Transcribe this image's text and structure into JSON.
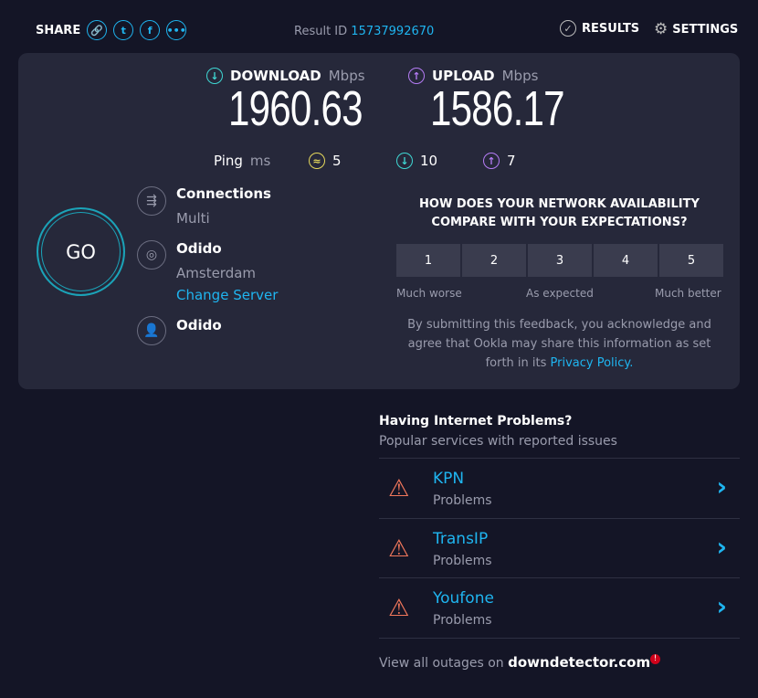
{
  "header": {
    "share": "SHARE",
    "result_id_label": "Result ID",
    "result_id": "15737992670",
    "results": "RESULTS",
    "settings": "SETTINGS"
  },
  "speed": {
    "download_label": "DOWNLOAD",
    "upload_label": "UPLOAD",
    "unit": "Mbps",
    "download": "1960.63",
    "upload": "1586.17",
    "ping_label": "Ping",
    "ping_unit": "ms",
    "ping_idle": "5",
    "ping_down": "10",
    "ping_up": "7"
  },
  "go": "GO",
  "server": {
    "connections_label": "Connections",
    "connections": "Multi",
    "host": "Odido",
    "location": "Amsterdam",
    "change": "Change Server",
    "provider": "Odido"
  },
  "survey": {
    "question": "HOW DOES YOUR NETWORK AVAILABILITY COMPARE WITH YOUR EXPECTATIONS?",
    "options": [
      "1",
      "2",
      "3",
      "4",
      "5"
    ],
    "low": "Much worse",
    "mid": "As expected",
    "high": "Much better",
    "disclaimer": "By submitting this feedback, you acknowledge and agree that Ookla may share this information as set forth in its",
    "privacy": "Privacy Policy."
  },
  "problems": {
    "title": "Having Internet Problems?",
    "subtitle": "Popular services with reported issues",
    "items": [
      {
        "name": "KPN",
        "status": "Problems"
      },
      {
        "name": "TransIP",
        "status": "Problems"
      },
      {
        "name": "Youfone",
        "status": "Problems"
      }
    ],
    "footer": "View all outages on",
    "site": "downdetector.com"
  }
}
